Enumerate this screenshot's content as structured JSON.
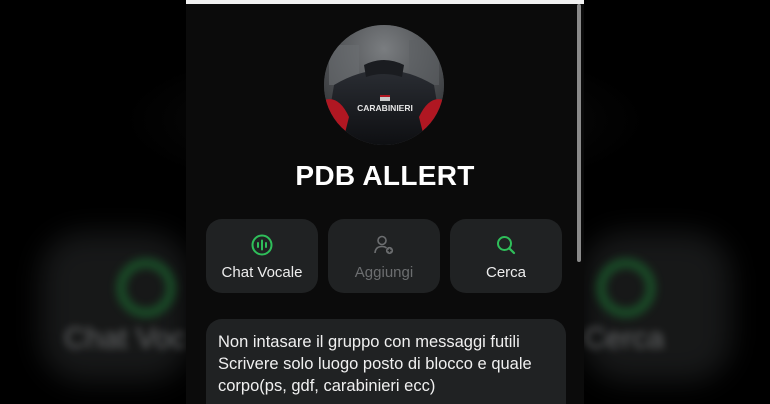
{
  "background": {
    "left_label": "Chat Voc",
    "right_label": "Cerca"
  },
  "group": {
    "name": "PDB ALLERT",
    "avatar_text": "CARABINIERI"
  },
  "actions": [
    {
      "label": "Chat Vocale",
      "icon": "voice-chat-icon",
      "enabled": true
    },
    {
      "label": "Aggiungi",
      "icon": "add-person-icon",
      "enabled": false
    },
    {
      "label": "Cerca",
      "icon": "search-icon",
      "enabled": true
    }
  ],
  "description": {
    "lines": [
      "Non intasare il gruppo con messaggi futili",
      "Scrivere solo luogo posto di blocco e quale",
      "corpo(ps, gdf, carabinieri ecc)"
    ]
  },
  "colors": {
    "accent": "#2fbf5a",
    "panel": "#202223",
    "background": "#0b0b0b"
  }
}
